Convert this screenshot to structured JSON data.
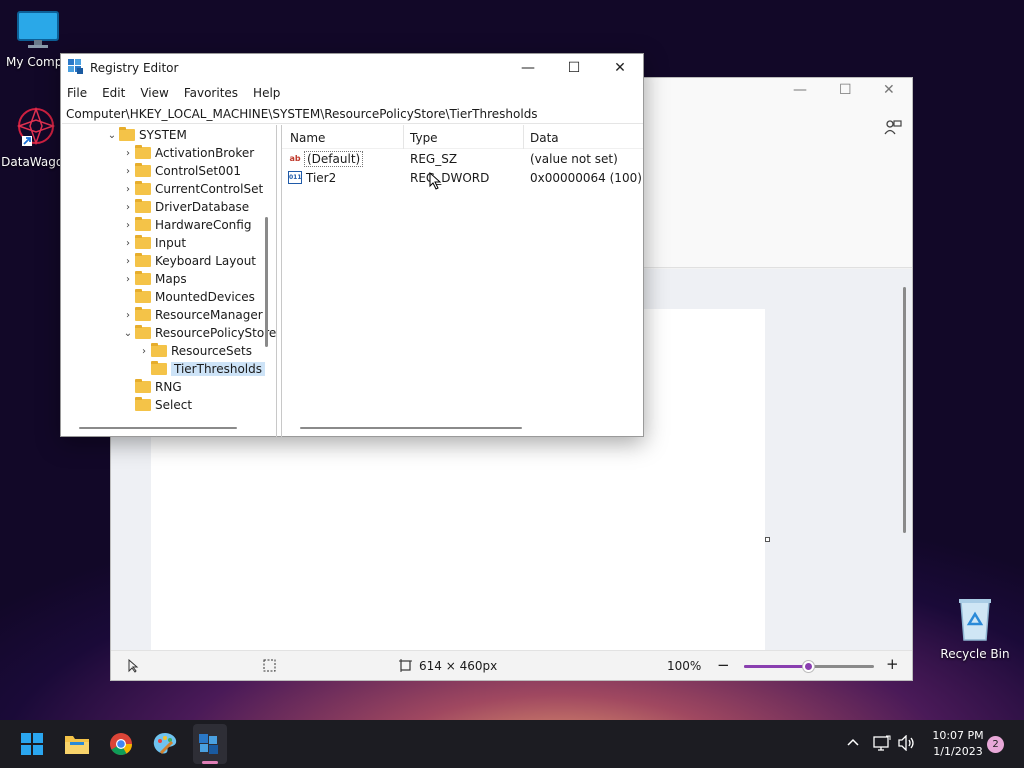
{
  "desktop": {
    "icons": [
      {
        "label": "My Compu",
        "icon": "monitor-icon"
      },
      {
        "label": "DataWagon",
        "icon": "datawagon-icon"
      },
      {
        "label": "Recycle Bin",
        "icon": "recycle-bin-icon"
      }
    ]
  },
  "paint": {
    "status": {
      "canvas_size": "614 × 460px",
      "zoom": "100%",
      "zoom_level": 0.5
    }
  },
  "registry": {
    "title": "Registry Editor",
    "menu": [
      "File",
      "Edit",
      "View",
      "Favorites",
      "Help"
    ],
    "address": "Computer\\HKEY_LOCAL_MACHINE\\SYSTEM\\ResourcePolicyStore\\TierThresholds",
    "tree": [
      {
        "label": "SYSTEM",
        "expanded": true,
        "depth": 0
      },
      {
        "label": "ActivationBroker",
        "depth": 1
      },
      {
        "label": "ControlSet001",
        "depth": 1
      },
      {
        "label": "CurrentControlSet",
        "depth": 1
      },
      {
        "label": "DriverDatabase",
        "depth": 1
      },
      {
        "label": "HardwareConfig",
        "depth": 1
      },
      {
        "label": "Input",
        "depth": 1
      },
      {
        "label": "Keyboard Layout",
        "depth": 1
      },
      {
        "label": "Maps",
        "depth": 1
      },
      {
        "label": "MountedDevices",
        "depth": 1
      },
      {
        "label": "ResourceManager",
        "depth": 1
      },
      {
        "label": "ResourcePolicyStore",
        "expanded": true,
        "depth": 1
      },
      {
        "label": "ResourceSets",
        "depth": 2
      },
      {
        "label": "TierThresholds",
        "depth": 2,
        "selected": true
      },
      {
        "label": "RNG",
        "depth": 1
      },
      {
        "label": "Select",
        "depth": 1
      }
    ],
    "columns": {
      "name": "Name",
      "type": "Type",
      "data": "Data"
    },
    "values": [
      {
        "name": "(Default)",
        "type": "REG_SZ",
        "data": "(value not set)",
        "icon": "string-value-icon"
      },
      {
        "name": "Tier2",
        "type": "REG_DWORD",
        "data": "0x00000064 (100)",
        "icon": "dword-value-icon"
      }
    ]
  },
  "taskbar": {
    "time": "10:07 PM",
    "date": "1/1/2023",
    "notifications": "2"
  }
}
